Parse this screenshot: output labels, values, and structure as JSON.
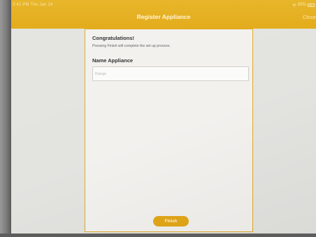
{
  "status_bar": {
    "time": "3:42 PM   Thu Jan 24",
    "battery": "85%"
  },
  "navbar": {
    "title": "Register Appliance",
    "close_label": "Close"
  },
  "panel": {
    "heading": "Congratulations!",
    "instruction": "Pressing Finish will complete the set up process.",
    "name_label": "Name Appliance",
    "name_input": {
      "value": "",
      "placeholder": "Range"
    },
    "finish_label": "Finish"
  },
  "colors": {
    "accent": "#e3ac1c",
    "panel_border": "#e0a828",
    "background": "#e3e3e0"
  }
}
